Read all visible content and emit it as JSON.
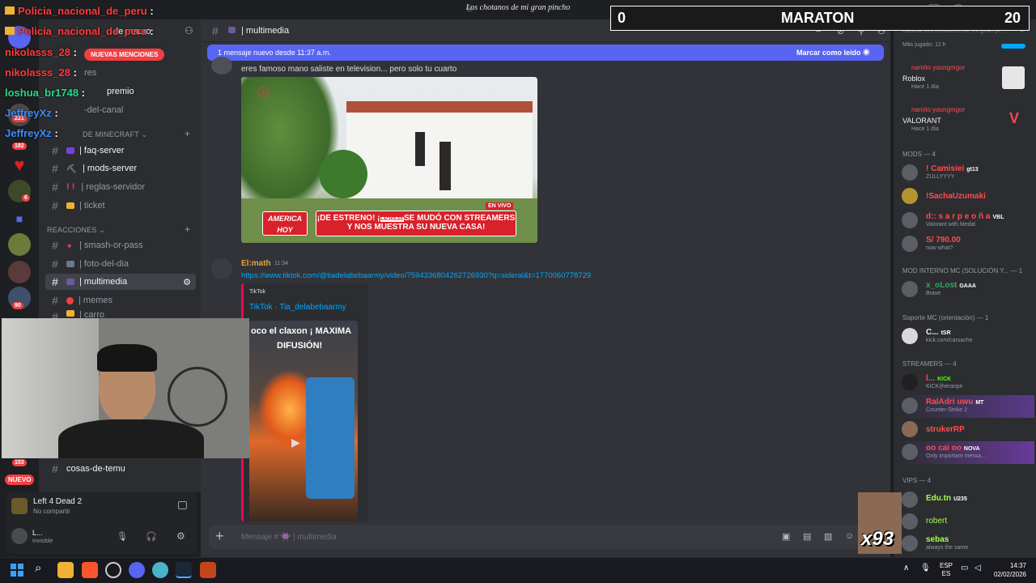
{
  "window": {
    "server_name": "Los chotanos de mi gran pincho"
  },
  "overlay": {
    "score": {
      "left": "0",
      "title": "MARATON",
      "right": "20"
    },
    "chat": [
      {
        "user": "Policia_nacional_de_peru",
        "suffix": ":",
        "color": "#ff3b3b"
      },
      {
        "user": "Policia_nacional_de_peru",
        "suffix": ":",
        "color": "#ff3b3b"
      },
      {
        "user": "nikolasss_28",
        "suffix": ":",
        "color": "#ff3b3b"
      },
      {
        "user": "nikolasss_28",
        "suffix": ":",
        "color": "#ff3b3b"
      },
      {
        "user": "loshua_br1748",
        "suffix": ":",
        "color": "#29d98c"
      },
      {
        "user": "JeffreyXz",
        "suffix": ":",
        "color": "#3b8cff"
      },
      {
        "user": "JeffreyXz",
        "suffix": ":",
        "color": "#3b8cff"
      }
    ],
    "counter": "x93"
  },
  "rail": {
    "badges": [
      "221",
      "182",
      "6",
      "90",
      "153"
    ],
    "new_label": "NUEVO",
    "mentions_pill": "NUEVAS MENCIONES"
  },
  "channels": {
    "header_fragments": [
      "de mauro",
      "res",
      "premio",
      "-del-canal"
    ],
    "category_minecraft": "DE MINECRAFT",
    "category_reactions": "REACCIONES",
    "items": [
      {
        "label": "| faq-server"
      },
      {
        "label": "| mods-server"
      },
      {
        "label": "| reglas-servidor"
      },
      {
        "label": "| ticket"
      },
      {
        "label": "| smash-or-pass"
      },
      {
        "label": "| foto-del-dia"
      },
      {
        "label": "| multimedia"
      },
      {
        "label": "| memes"
      },
      {
        "label": "| carro"
      },
      {
        "label": "cosas-de-temu"
      }
    ]
  },
  "activity": {
    "game": "Left 4 Dead 2",
    "status": "No compartir"
  },
  "user": {
    "name": "L...",
    "status": "Invisible"
  },
  "chat": {
    "channel_title": "| multimedia",
    "new_messages": "1 mensaje nuevo desde 11:37 a.m.",
    "mark_read": "Marcar como leído",
    "first_message": "eres famoso mano saliste en television... pero solo tu cuarto",
    "tv": {
      "live": "EN VIVO",
      "logo": "AMERICA HOY",
      "headline_1": "¡DE ESTRENO! ¡",
      "headline_mid": "LACHOLEX",
      "headline_2": "SE MUDÓ CON STREAMERS",
      "headline_3": "Y NOS MUESTRA SU NUEVA CASA!"
    },
    "second_author": "El:math",
    "second_time": "11:34",
    "link": "https://www.tiktok.com/@tiadelabebaarmy/video/7594336804262726930?q=sideral&t=1770060778729",
    "embed_provider": "TikTok",
    "embed_title": "TikTok · Tia_delabebaarmy",
    "embed_caption_1": "oco el claxon ¡ MAXIMA",
    "embed_caption_2": "DIFUSIÓN!",
    "composer_placeholder": "Mensaje # 👾 | multimedia"
  },
  "members": {
    "search_placeholder": "Buscar los chotanos de mi gran pi...",
    "most_played": "Más jugado: 12 h",
    "activities": [
      {
        "name": "namito youngmgor",
        "game": "Roblox",
        "time": "Hace 1 día"
      },
      {
        "name": "namito youngmgor",
        "game": "VALORANT",
        "time": "Hace 1 día"
      }
    ],
    "sections": [
      {
        "title": "MODS — 4",
        "members": [
          {
            "name": "! Camisiei",
            "tag": "gt13",
            "status": "ZULLYYYY",
            "color": "#ff4d4d"
          },
          {
            "name": "!SachaUzumaki",
            "tag": "",
            "status": "",
            "color": "#ff4d4d"
          },
          {
            "name": "d:: s a r p e o ñ a",
            "tag": "VBL",
            "status": "Valorant with Medal",
            "color": "#ff4d4d"
          },
          {
            "name": "S/ 790.00",
            "tag": "",
            "status": "now what?",
            "color": "#ff4d4d"
          }
        ]
      },
      {
        "title": "MOD INTERNO MC (SOLUCIÓN Y... — 1",
        "members": [
          {
            "name": "x_oLost",
            "tag": "GAAA",
            "status": "Brave",
            "color": "#3ba55c"
          }
        ]
      },
      {
        "title": "Soporte MC (orientación) — 1",
        "members": [
          {
            "name": "C...",
            "tag": "tSR",
            "status": "kick.com/carsache",
            "color": "#f2f3f5"
          }
        ]
      },
      {
        "title": "STREAMERS — 4",
        "members": [
          {
            "name": "l...",
            "tag": "KICK",
            "status": "KICK/jheranpe",
            "color": "#ff4d4d"
          },
          {
            "name": "RaIAdri uwu",
            "tag": "MT",
            "status": "Counter-Strike 2",
            "color": "#ff4d4d"
          },
          {
            "name": "strukerRP",
            "tag": "",
            "status": "",
            "color": "#ff4d4d"
          },
          {
            "name": "oo cai oo",
            "tag": "NOVA",
            "status": "Only important messa...",
            "color": "#ff4d4d"
          }
        ]
      },
      {
        "title": "VIPS — 4",
        "members": [
          {
            "name": "Edu.tn",
            "tag": "U235",
            "status": "",
            "color": "#a3ff47"
          },
          {
            "name": "robert",
            "tag": "",
            "status": "",
            "color": "#a3ff47"
          },
          {
            "name": "sebas",
            "tag": "",
            "status": "always the same",
            "color": "#a3ff47"
          }
        ]
      }
    ]
  },
  "taskbar": {
    "lang_1": "ESP",
    "lang_2": "ES",
    "time": "14:37",
    "date": "02/02/2026"
  }
}
